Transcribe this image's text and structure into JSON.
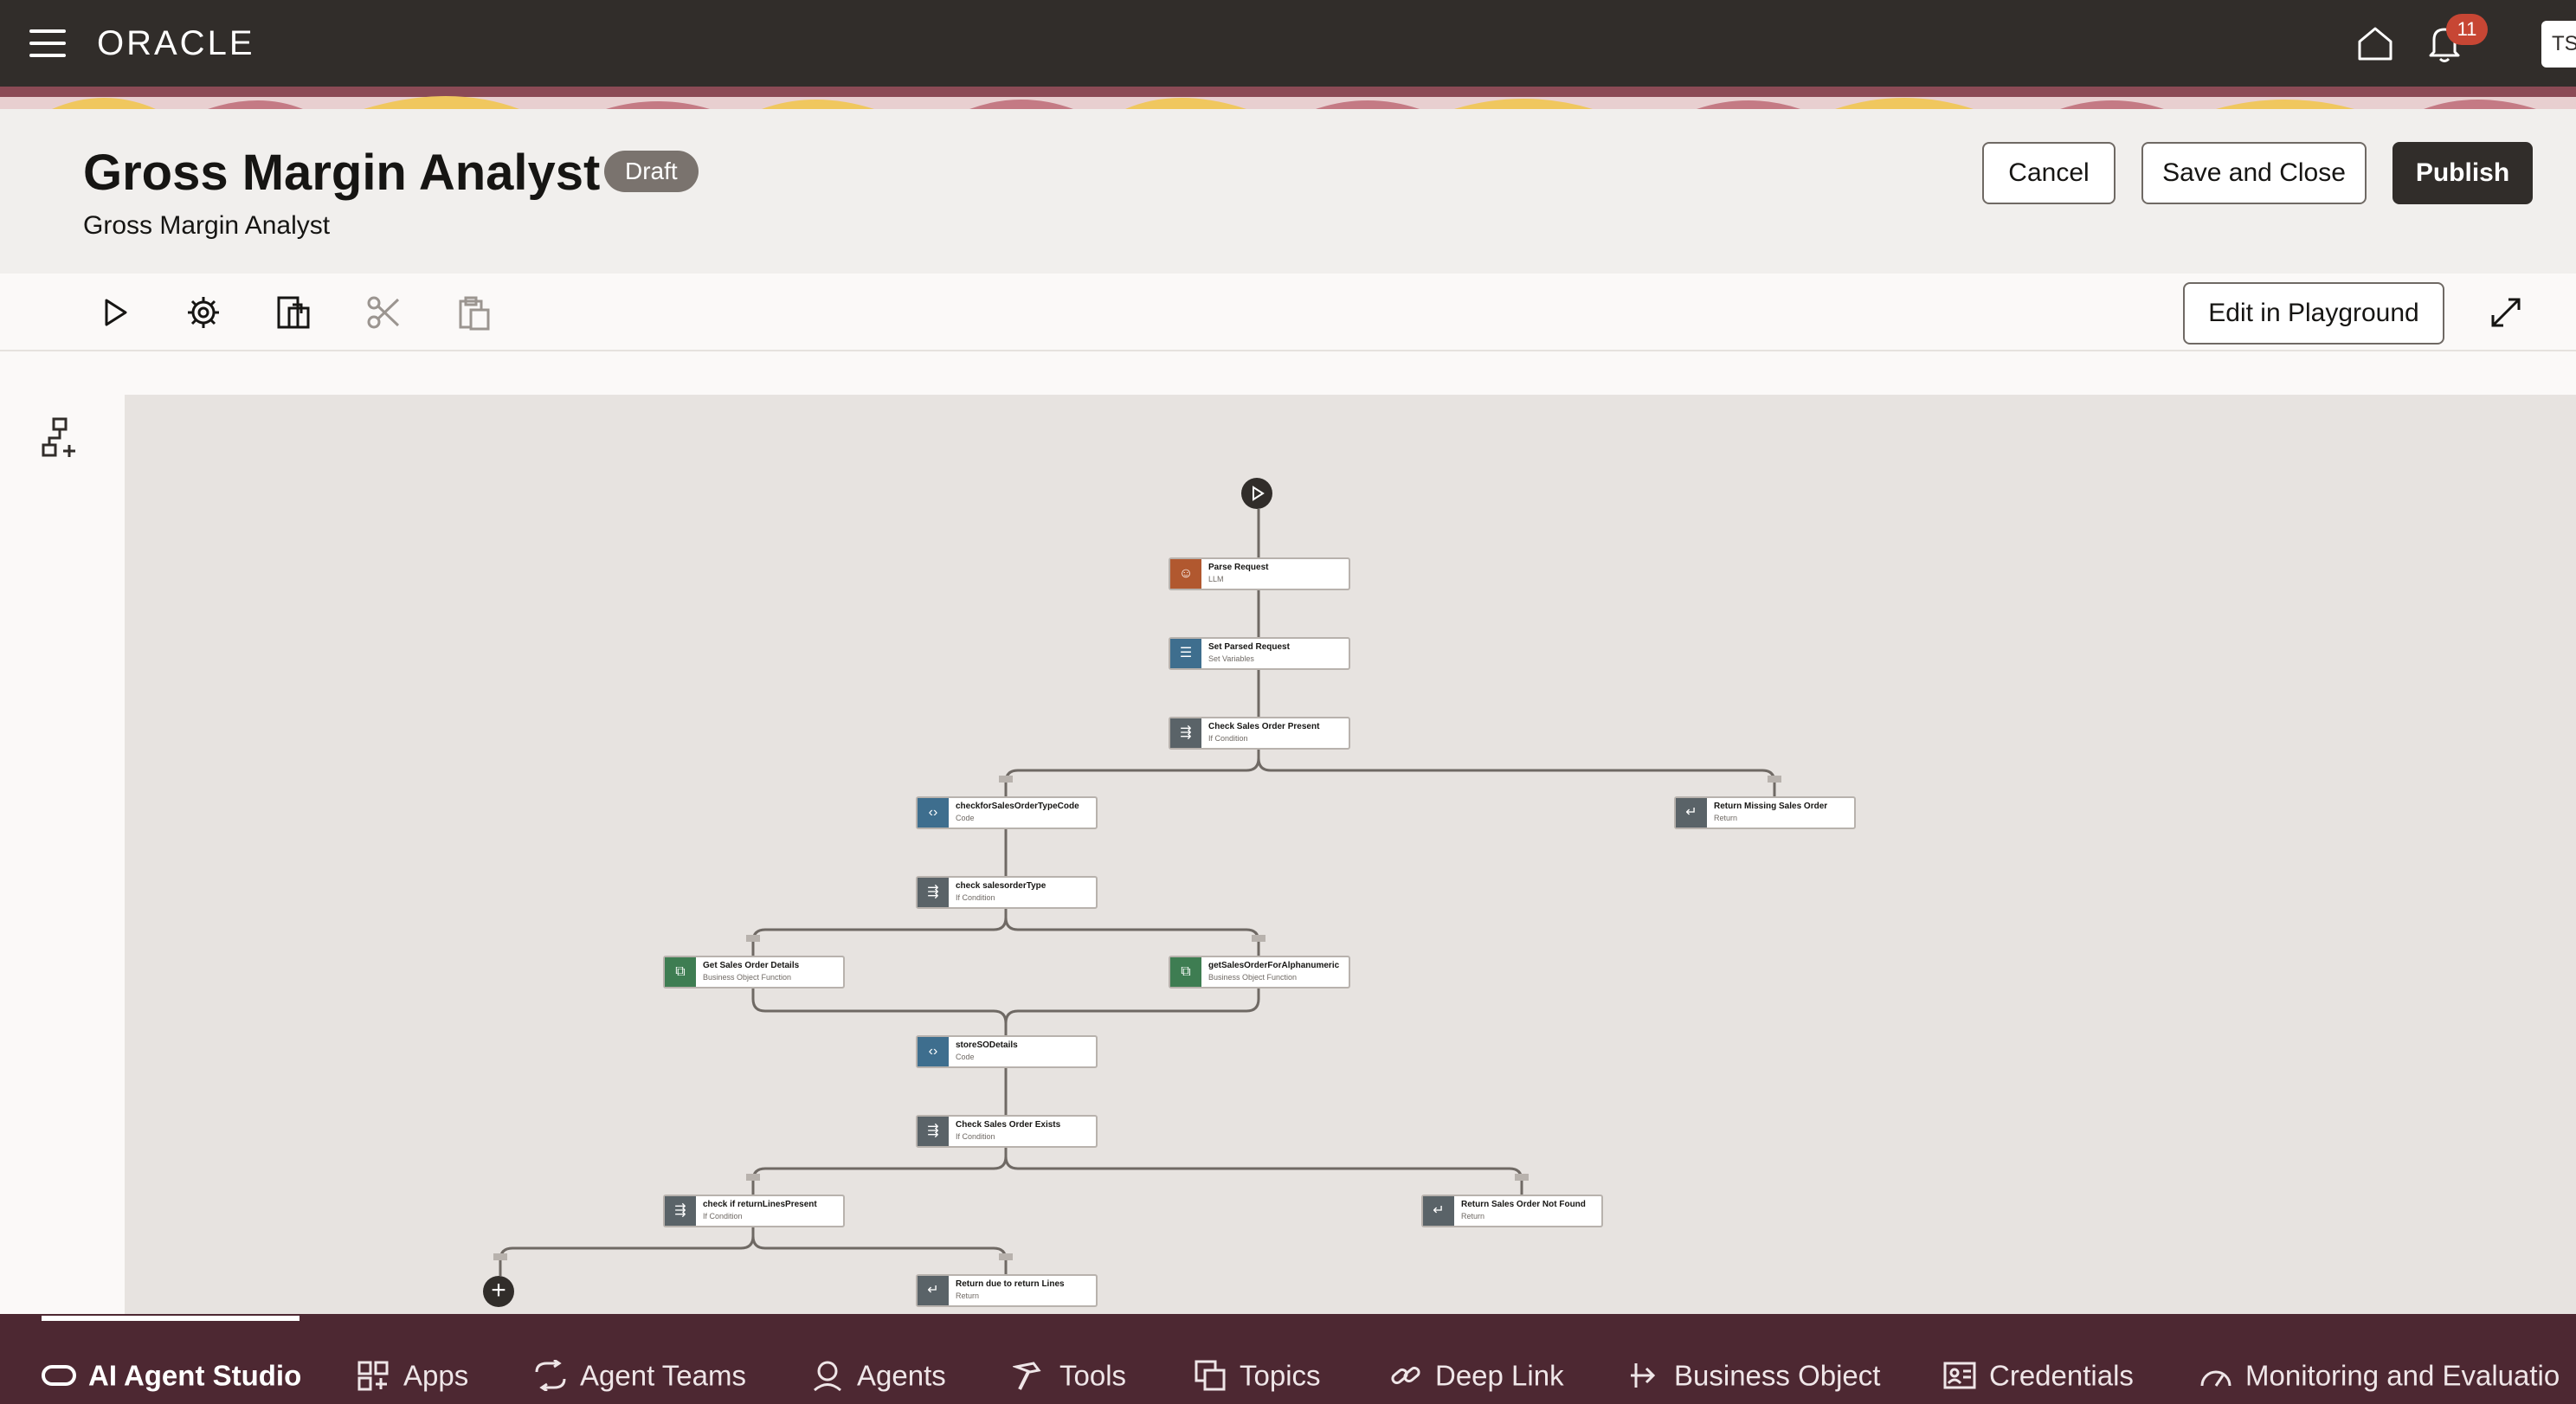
{
  "topbar": {
    "logo": "ORACLE",
    "notification_count": "11",
    "avatar_initials": "TS"
  },
  "header": {
    "title": "Gross Margin Analyst",
    "status": "Draft",
    "subtitle": "Gross Margin Analyst",
    "cancel_label": "Cancel",
    "save_close_label": "Save and Close",
    "publish_label": "Publish"
  },
  "toolbar": {
    "tools": [
      "play-icon",
      "settings-icon",
      "export-icon",
      "scissors-icon",
      "paste-icon"
    ],
    "playground_label": "Edit in Playground"
  },
  "flow": {
    "nodes": [
      {
        "title": "Parse Request",
        "type": "LLM"
      },
      {
        "title": "Set Parsed Request",
        "type": "Set Variables"
      },
      {
        "title": "Check Sales Order Present",
        "type": "If Condition"
      },
      {
        "title": "checkforSalesOrderTypeCode",
        "type": "Code"
      },
      {
        "title": "Return Missing Sales Order",
        "type": "Return"
      },
      {
        "title": "check salesorderType",
        "type": "If Condition"
      },
      {
        "title": "Get Sales Order Details",
        "type": "Business Object Function"
      },
      {
        "title": "getSalesOrderForAlphanumeric",
        "type": "Business Object Function"
      },
      {
        "title": "storeSODetails",
        "type": "Code"
      },
      {
        "title": "Check Sales Order Exists",
        "type": "If Condition"
      },
      {
        "title": "check if returnLinesPresent",
        "type": "If Condition"
      },
      {
        "title": "Return Sales Order Not Found",
        "type": "Return"
      },
      {
        "title": "Return due to return Lines",
        "type": "Return"
      }
    ]
  },
  "bottom_nav": {
    "items": [
      {
        "label": "AI Agent Studio",
        "icon": "pill-icon"
      },
      {
        "label": "Apps",
        "icon": "grid-icon"
      },
      {
        "label": "Agent Teams",
        "icon": "agent-teams-icon"
      },
      {
        "label": "Agents",
        "icon": "agent-icon"
      },
      {
        "label": "Tools",
        "icon": "hammer-icon"
      },
      {
        "label": "Topics",
        "icon": "topics-icon"
      },
      {
        "label": "Deep Link",
        "icon": "link-icon"
      },
      {
        "label": "Business Object",
        "icon": "business-object-icon"
      },
      {
        "label": "Credentials",
        "icon": "credentials-icon"
      },
      {
        "label": "Monitoring and Evaluatio",
        "icon": "gauge-icon"
      }
    ]
  }
}
